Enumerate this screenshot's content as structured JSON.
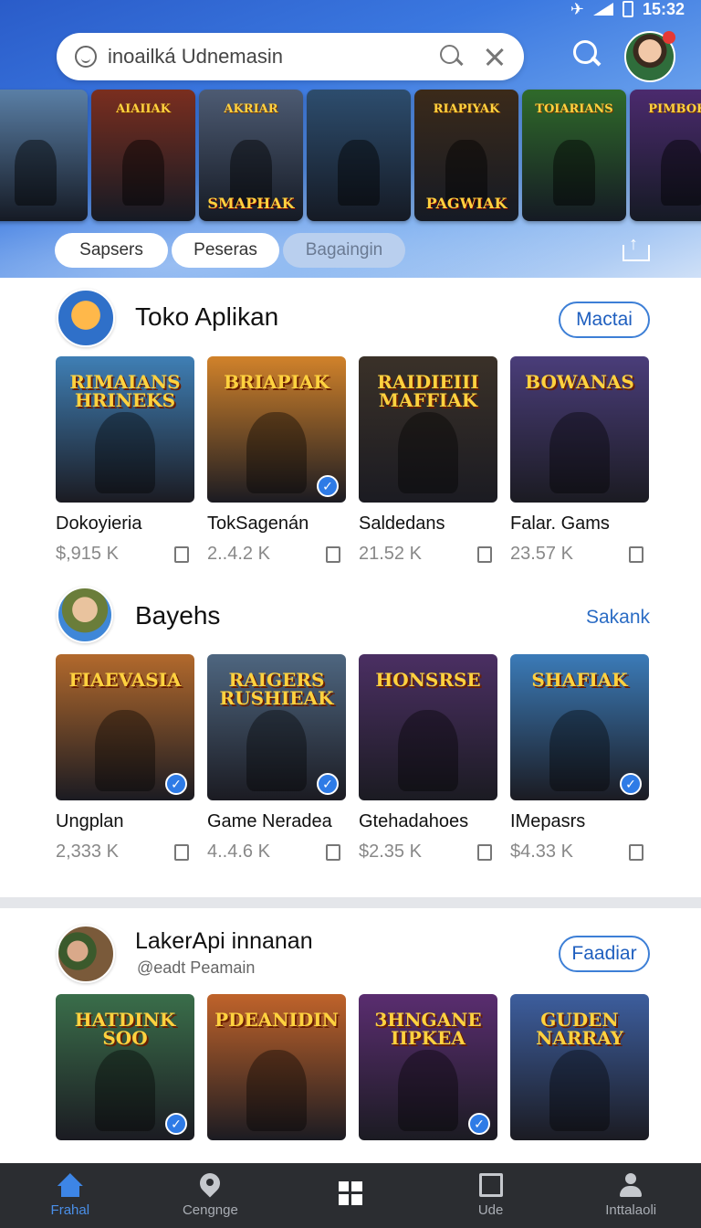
{
  "status_bar": {
    "time": "15:32"
  },
  "search": {
    "text": "inoailká Udnemasin"
  },
  "banners": [
    {
      "title": "",
      "big": "",
      "bg": "#5a7fa6"
    },
    {
      "title": "AIAIIAK",
      "big": "",
      "bg": "#7a2e1f"
    },
    {
      "title": "AKRIAR",
      "big": "SMAPHAK",
      "bg": "#4d5b73"
    },
    {
      "title": "",
      "big": "",
      "bg": "#2d4d6e"
    },
    {
      "title": "RIAPIYAK",
      "big": "PAGWIAK",
      "bg": "#3b2a1a"
    },
    {
      "title": "TOIARIANS",
      "big": "",
      "bg": "#2f6a2a"
    },
    {
      "title": "PIMBOKS",
      "big": "",
      "bg": "#4b2a6e"
    },
    {
      "title": "",
      "big": "",
      "bg": "#8aa0c0"
    }
  ],
  "pills": [
    {
      "label": "Sapsers",
      "muted": false
    },
    {
      "label": "Peseras",
      "muted": false
    },
    {
      "label": "Bagaingin",
      "muted": true
    }
  ],
  "sections": [
    {
      "title": "Toko Aplikan",
      "subtitle": "",
      "button": "Mactai",
      "button_style": "outline",
      "apps": [
        {
          "name": "Dokoyieria",
          "size": "$,915 K",
          "thumb_title": "RIMAIANS HRINEKS",
          "thumb_bg": "#3f7fb5",
          "verified": false
        },
        {
          "name": "TokSagenán",
          "size": "2..4.2 K",
          "thumb_title": "BRIAPIAK",
          "thumb_bg": "#d1822a",
          "verified": true
        },
        {
          "name": "Saldedans",
          "size": "21.52 K",
          "thumb_title": "RAIDIEIII MAFFIAK",
          "thumb_bg": "#3a3128",
          "verified": false
        },
        {
          "name": "Falar. Gams",
          "size": "23.57 K",
          "thumb_title": "BOWANAS",
          "thumb_bg": "#4a3d7a",
          "verified": false
        }
      ]
    },
    {
      "title": "Bayehs",
      "subtitle": "",
      "button": "Sakank",
      "button_style": "link",
      "apps": [
        {
          "name": "Ungplan",
          "size": "2,333 K",
          "thumb_title": "FIAEVASIA",
          "thumb_bg": "#b2692c",
          "verified": true
        },
        {
          "name": "Game Neradea",
          "size": "4..4.6 K",
          "thumb_title": "RAIGERS RUSHIEAK",
          "thumb_bg": "#4e6680",
          "verified": true
        },
        {
          "name": "Gtehadahoes",
          "size": "$2.35 K",
          "thumb_title": "HONSRSE",
          "thumb_bg": "#4b2f63",
          "verified": false
        },
        {
          "name": "IMepasrs",
          "size": "$4.33 K",
          "thumb_title": "SHAFIAK",
          "thumb_bg": "#3b7bb8",
          "verified": true
        }
      ]
    },
    {
      "title": "LakerApi innanan",
      "subtitle": "@eadt Peamain",
      "button": "Faadiar",
      "button_style": "outline",
      "apps": [
        {
          "name": "",
          "size": "",
          "thumb_title": "HATDINK SOO",
          "thumb_bg": "#3a6e4a",
          "verified": true
        },
        {
          "name": "",
          "size": "",
          "thumb_title": "PDEANIDIN",
          "thumb_bg": "#c0632a",
          "verified": false
        },
        {
          "name": "",
          "size": "",
          "thumb_title": "3HNGANE IIPKEA",
          "thumb_bg": "#5a2d70",
          "verified": true
        },
        {
          "name": "",
          "size": "",
          "thumb_title": "GUDEN NARRAY",
          "thumb_bg": "#3d5e9e",
          "verified": false
        }
      ]
    }
  ],
  "nav": [
    {
      "label": "Frahal",
      "icon": "home-icon",
      "active": true
    },
    {
      "label": "Cengnge",
      "icon": "location-pin-icon",
      "active": false
    },
    {
      "label": "",
      "icon": "grid-icon",
      "active": false
    },
    {
      "label": "Ude",
      "icon": "square-icon",
      "active": false
    },
    {
      "label": "Inttalaoli",
      "icon": "person-icon",
      "active": false
    }
  ]
}
